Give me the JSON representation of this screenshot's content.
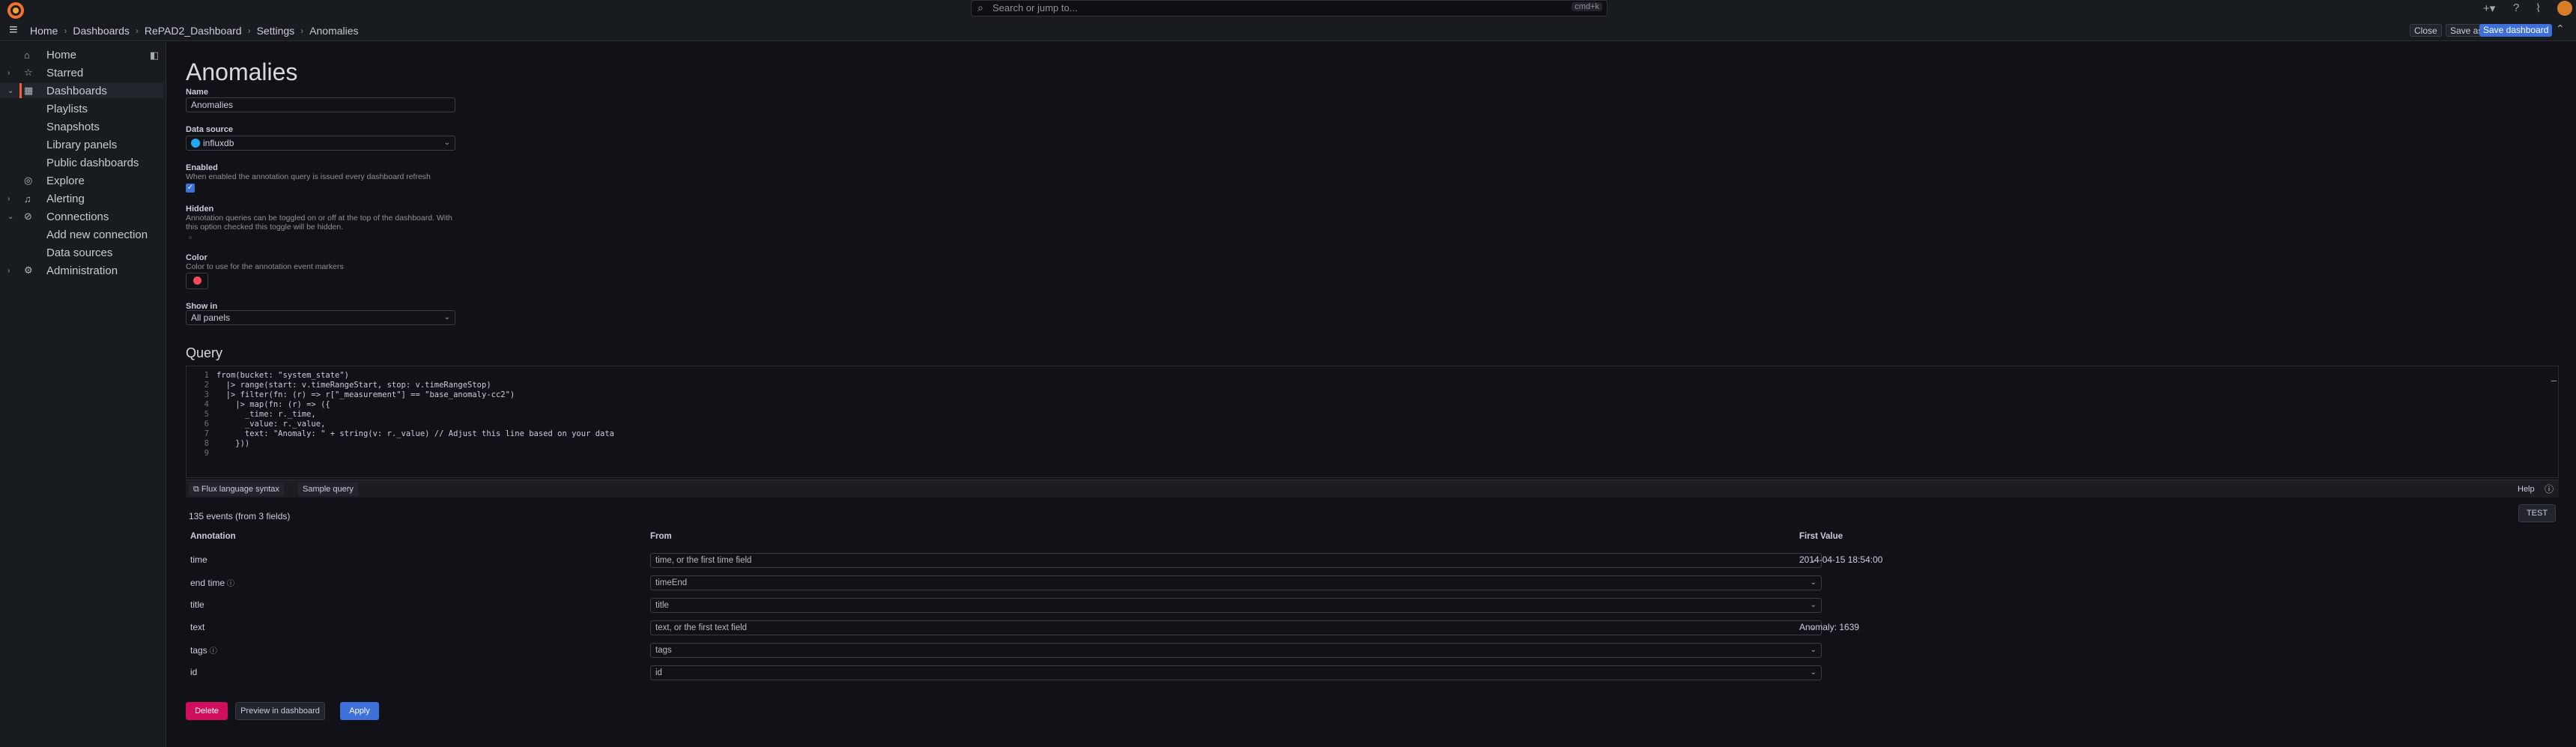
{
  "topbar": {
    "search_placeholder": "Search or jump to...",
    "search_shortcut": "cmd+k",
    "breadcrumb": [
      "Home",
      "Dashboards",
      "RePAD2_Dashboard",
      "Settings",
      "Anomalies"
    ],
    "close_label": "Close",
    "save_as_label": "Save as",
    "save_dashboard_label": "Save dashboard"
  },
  "sidebar": {
    "items": [
      {
        "label": "Home",
        "icon": "home-icon"
      },
      {
        "label": "Starred",
        "icon": "star-icon"
      },
      {
        "label": "Dashboards",
        "icon": "apps-icon"
      },
      {
        "label": "Playlists"
      },
      {
        "label": "Snapshots"
      },
      {
        "label": "Library panels"
      },
      {
        "label": "Public dashboards"
      },
      {
        "label": "Explore",
        "icon": "compass-icon"
      },
      {
        "label": "Alerting",
        "icon": "bell-icon"
      },
      {
        "label": "Connections",
        "icon": "plug-icon"
      },
      {
        "label": "Add new connection"
      },
      {
        "label": "Data sources"
      },
      {
        "label": "Administration",
        "icon": "cog-icon"
      }
    ]
  },
  "form": {
    "title": "Anomalies",
    "name_label": "Name",
    "name_value": "Anomalies",
    "datasource_label": "Data source",
    "datasource_value": "influxdb",
    "enabled_label": "Enabled",
    "enabled_desc": "When enabled the annotation query is issued every dashboard refresh",
    "enabled_checked": true,
    "hidden_label": "Hidden",
    "hidden_desc": "Annotation queries can be toggled on or off at the top of the dashboard. With this option checked this toggle will be hidden.",
    "color_label": "Color",
    "color_desc": "Color to use for the annotation event markers",
    "color_value": "#f2495c",
    "show_in_label": "Show in",
    "show_in_value": "All panels"
  },
  "query": {
    "title": "Query",
    "lines": [
      "from(bucket: \"system_state\")",
      "  |> range(start: v.timeRangeStart, stop: v.timeRangeStop)",
      "  |> filter(fn: (r) => r[\"_measurement\"] == \"base_anomaly-cc2\")",
      "    |> map(fn: (r) => ({",
      "      _time: r._time,",
      "      _value: r._value,",
      "      text: \"Anomaly: \" + string(v: r._value) // Adjust this line based on your data",
      "    }))",
      ""
    ],
    "flux_syntax_label": "Flux language syntax",
    "sample_query_label": "Sample query",
    "help_label": "Help"
  },
  "results": {
    "events_text": "135 events (from 3 fields)",
    "test_label": "TEST",
    "headers": [
      "Annotation",
      "From",
      "First Value"
    ],
    "rows": [
      {
        "annotation": "time",
        "from": "time, or the first time field",
        "value": "2014-04-15 18:54:00",
        "info": false
      },
      {
        "annotation": "end time",
        "from": "timeEnd",
        "value": "",
        "info": true
      },
      {
        "annotation": "title",
        "from": "title",
        "value": "",
        "info": false
      },
      {
        "annotation": "text",
        "from": "text, or the first text field",
        "value": "Anomaly: 1639",
        "info": false
      },
      {
        "annotation": "tags",
        "from": "tags",
        "value": "",
        "info": true
      },
      {
        "annotation": "id",
        "from": "id",
        "value": "",
        "info": false
      }
    ]
  },
  "actions": {
    "delete_label": "Delete",
    "preview_label": "Preview in dashboard",
    "apply_label": "Apply"
  }
}
